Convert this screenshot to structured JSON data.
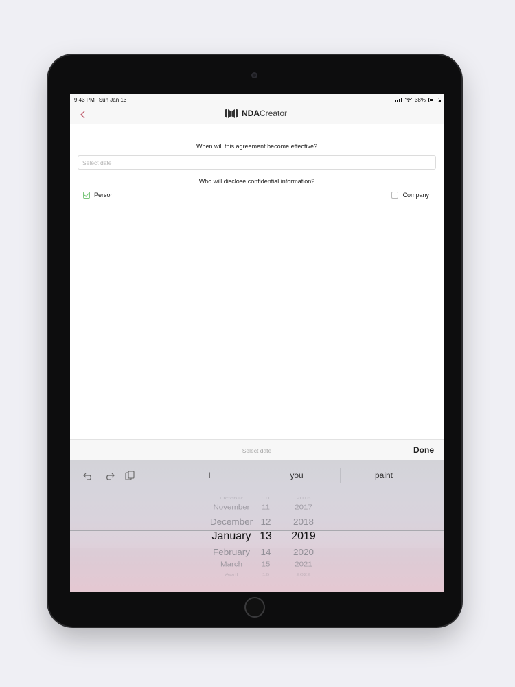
{
  "status_bar": {
    "time": "9:43 PM",
    "date": "Sun Jan 13",
    "battery": "38%",
    "battery_level": 0.38
  },
  "nav": {
    "logo_bold": "NDA",
    "logo_light": "Creator"
  },
  "form": {
    "question_effective": "When will this agreement become effective?",
    "date_placeholder": "Select date",
    "question_disclose": "Who will disclose confidential information?",
    "options": [
      {
        "label": "Person",
        "checked": true
      },
      {
        "label": "Company",
        "checked": false
      }
    ]
  },
  "picker_toolbar": {
    "label": "Select date",
    "done_label": "Done"
  },
  "keyboard": {
    "suggestions": [
      "I",
      "you",
      "paint"
    ]
  },
  "date_picker": {
    "months": [
      "October",
      "November",
      "December",
      "January",
      "February",
      "March",
      "April"
    ],
    "days": [
      "10",
      "11",
      "12",
      "13",
      "14",
      "15",
      "16"
    ],
    "years": [
      "2016",
      "2017",
      "2018",
      "2019",
      "2020",
      "2021",
      "2022"
    ],
    "selected_index": 3
  },
  "colors": {
    "check_green": "#7bc67c",
    "accent_back": "#c06070"
  }
}
